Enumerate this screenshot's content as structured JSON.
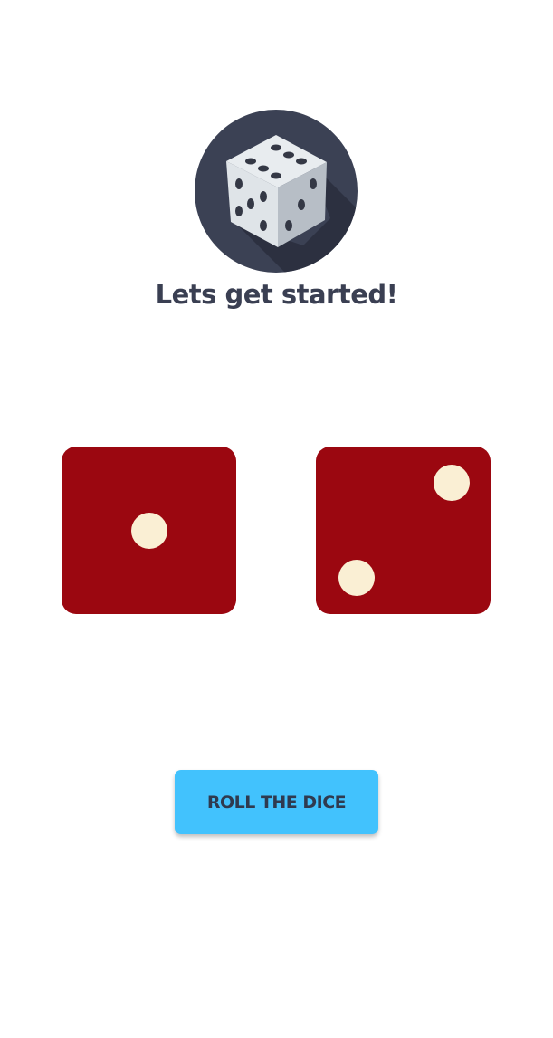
{
  "header": {
    "logo_icon": "dice-icon",
    "title": "Lets get started!"
  },
  "dice": {
    "left": {
      "value": 1,
      "color": "#9b0710",
      "pip_color": "#faefd4"
    },
    "right": {
      "value": 2,
      "color": "#9b0710",
      "pip_color": "#faefd4"
    }
  },
  "actions": {
    "roll_label": "ROLL THE DICE",
    "roll_color": "#42c2fd"
  }
}
